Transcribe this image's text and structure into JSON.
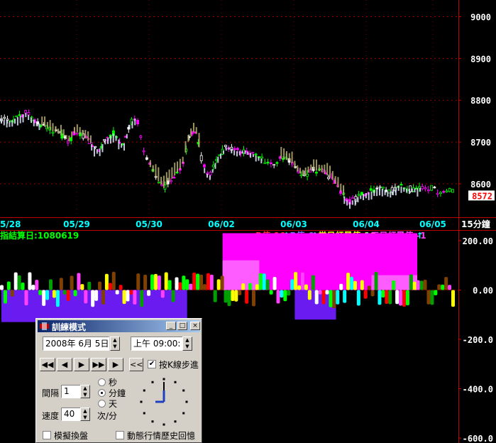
{
  "price_axis": {
    "labels": [
      "9000",
      "8900",
      "8800",
      "8700",
      "8600"
    ],
    "levels": [
      9000,
      8900,
      8800,
      8700,
      8600
    ],
    "current": "8572",
    "current_value": 8572,
    "color": "#ffffff",
    "current_color": "#ff0000"
  },
  "time_axis": {
    "labels": [
      "5/28",
      "05/29",
      "05/30",
      "06/02",
      "06/03",
      "06/04",
      "06/05"
    ],
    "period": "15分鐘",
    "color": "#00ffff"
  },
  "indicator": {
    "settlement": "指結算日:1080619",
    "legend": [
      {
        "text": "R值:10",
        "color": "#ff3030"
      },
      {
        "text": "B值:0",
        "color": "#7070ff"
      },
      {
        "text": "當日紅黑值:10",
        "color": "#ffff00"
      },
      {
        "text": "三日紅黑值:-1",
        "color": "#ff40ff"
      }
    ],
    "arrow": "↑",
    "axis_labels": [
      "200.00",
      "0.00",
      "-200.0",
      "-400.0",
      "-600.0"
    ],
    "axis_levels": [
      200,
      0,
      -200,
      -400,
      -600
    ]
  },
  "dialog": {
    "title": "訓練模式",
    "date": "2008年 6月 5日",
    "time": "上午 09:00:",
    "controls": [
      "◀◀",
      "◀",
      "▶",
      "▶▶",
      "▶",
      "<<"
    ],
    "step_check": "✔",
    "step_label": "按K線步進",
    "interval_label": "間隔",
    "interval_value": "1",
    "speed_label": "速度",
    "speed_value": "40",
    "units": [
      "秒",
      "分鐘",
      "天"
    ],
    "selected_unit": "分鐘",
    "speed_unit": "次/分",
    "simulate_label": "模擬換盤",
    "replay_label": "動態行情歷史回憶",
    "win_buttons": [
      "_",
      "□",
      "×"
    ]
  },
  "chart_data": {
    "type": "candlestick",
    "price_ylim": [
      8520,
      9040
    ],
    "indicator_ylim": [
      -620,
      240
    ],
    "x_labels": [
      "5/28",
      "05/29",
      "05/30",
      "06/02",
      "06/03",
      "06/04",
      "06/05"
    ],
    "price_path": [
      [
        0,
        8755
      ],
      [
        0.02,
        8750
      ],
      [
        0.04,
        8762
      ],
      [
        0.055,
        8770
      ],
      [
        0.07,
        8755
      ],
      [
        0.09,
        8740
      ],
      [
        0.11,
        8728
      ],
      [
        0.13,
        8718
      ],
      [
        0.15,
        8702
      ],
      [
        0.165,
        8725
      ],
      [
        0.18,
        8715
      ],
      [
        0.2,
        8695
      ],
      [
        0.215,
        8680
      ],
      [
        0.23,
        8705
      ],
      [
        0.25,
        8722
      ],
      [
        0.27,
        8690
      ],
      [
        0.285,
        8745
      ],
      [
        0.3,
        8760
      ],
      [
        0.31,
        8700
      ],
      [
        0.33,
        8640
      ],
      [
        0.345,
        8610
      ],
      [
        0.36,
        8590
      ],
      [
        0.38,
        8615
      ],
      [
        0.4,
        8640
      ],
      [
        0.415,
        8705
      ],
      [
        0.43,
        8730
      ],
      [
        0.445,
        8650
      ],
      [
        0.46,
        8615
      ],
      [
        0.48,
        8665
      ],
      [
        0.5,
        8690
      ],
      [
        0.52,
        8678
      ],
      [
        0.54,
        8680
      ],
      [
        0.56,
        8670
      ],
      [
        0.58,
        8658
      ],
      [
        0.6,
        8648
      ],
      [
        0.62,
        8660
      ],
      [
        0.64,
        8655
      ],
      [
        0.655,
        8630
      ],
      [
        0.67,
        8618
      ],
      [
        0.69,
        8635
      ],
      [
        0.71,
        8628
      ],
      [
        0.73,
        8615
      ],
      [
        0.75,
        8585
      ],
      [
        0.77,
        8555
      ],
      [
        0.785,
        8565
      ],
      [
        0.8,
        8575
      ],
      [
        0.82,
        8582
      ],
      [
        0.84,
        8590
      ],
      [
        0.86,
        8580
      ],
      [
        0.88,
        8596
      ],
      [
        0.9,
        8588
      ],
      [
        0.93,
        8590
      ],
      [
        0.95,
        8592
      ],
      [
        0.97,
        8580
      ],
      [
        1.0,
        8585
      ]
    ],
    "indicator_blocks": [
      {
        "x": [
          0.0,
          0.49
        ],
        "y": [
          0,
          -130
        ],
        "color": "#6a1cf0"
      },
      {
        "x": [
          0.49,
          1.0
        ],
        "y": [
          0,
          230
        ],
        "color": "#ff00ff"
      },
      {
        "x": [
          0.49,
          0.65
        ],
        "y": [
          0,
          120
        ],
        "color": "#ff5cff"
      },
      {
        "x": [
          0.65,
          0.82
        ],
        "y": [
          0,
          -120
        ],
        "color": "#6a1cf0"
      },
      {
        "x": [
          0.82,
          1.0
        ],
        "y": [
          0,
          60
        ],
        "color": "#ff5cff"
      }
    ]
  }
}
